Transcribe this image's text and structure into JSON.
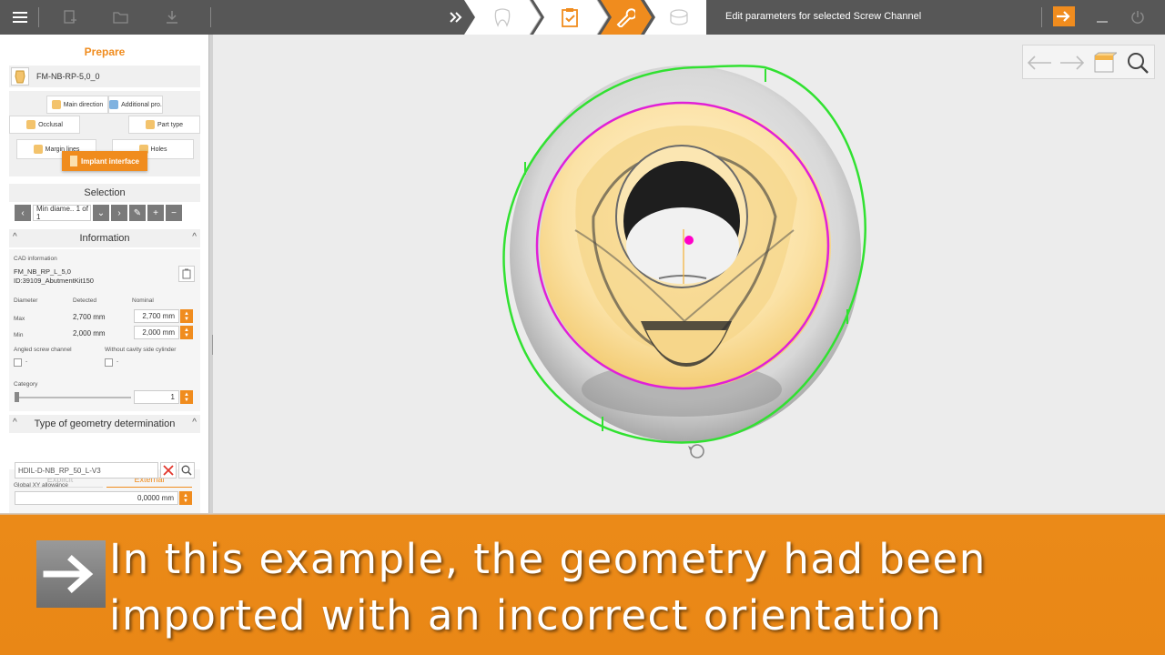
{
  "topbar": {
    "status_text": "Edit parameters for selected Screw Channel",
    "colors": {
      "background": "#575757",
      "accent": "#f08c1e",
      "step_inactive": "#ffffff"
    }
  },
  "panel": {
    "title": "Prepare",
    "part_name": "FM-NB-RP-5,0_0",
    "buttons": {
      "main_direction": "Main direction",
      "additional_pro": "Additional pro.",
      "occlusal": "Occlusal",
      "part_type": "Part type",
      "margin_lines": "Margin lines",
      "holes": "Holes",
      "implant_interface": "Implant interface"
    },
    "selection": {
      "header": "Selection",
      "current": "Min diame.. 1 of 1"
    },
    "information": {
      "header": "Information",
      "cad_label": "CAD information",
      "cad_line1": "FM_NB_RP_L_5,0",
      "cad_line2": "ID:39109_AbutmentKit150",
      "col_diameter": "Diameter",
      "col_detected": "Detected",
      "col_nominal": "Nominal",
      "max_label": "Max",
      "max_detected": "2,700 mm",
      "max_nominal": "2,700  mm",
      "min_label": "Min",
      "min_detected": "2,000 mm",
      "min_nominal": "2,000  mm",
      "angled_label": "Angled screw channel",
      "angled_value": "-",
      "without_label": "Without cavity side cylinder",
      "without_value": "-",
      "category_label": "Category",
      "category_value": "1"
    },
    "geometry": {
      "header": "Type of geometry determination",
      "tab_explicit": "Explicit",
      "tab_external": "External",
      "file": "HDIL-D-NB_RP_50_L-V3",
      "allowance_label": "Global XY allowance",
      "allowance_value": "0,0000  mm"
    }
  },
  "caption": {
    "line1": "In this example, the geometry had been",
    "line2": "imported with an incorrect orientation"
  }
}
